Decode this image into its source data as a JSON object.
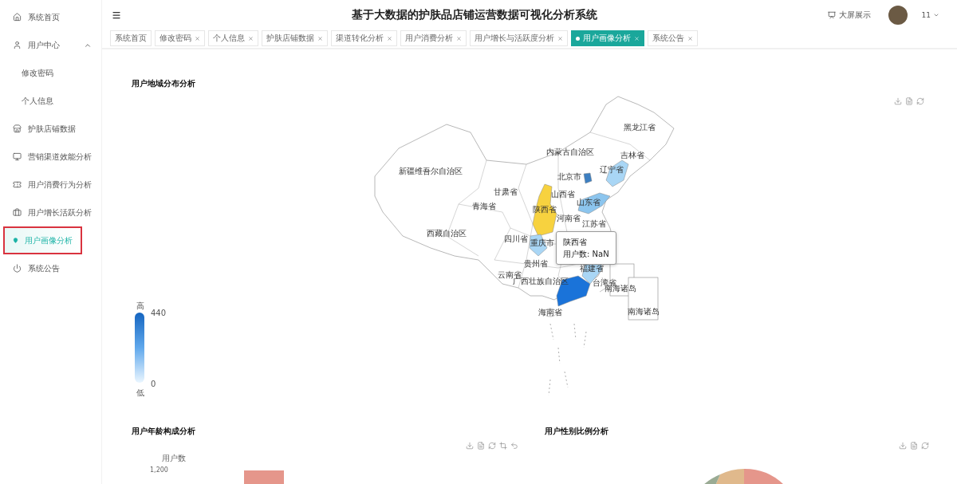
{
  "header": {
    "title": "基于大数据的护肤品店铺运营数据可视化分析系统",
    "screen_button": "大屏展示",
    "user": "11"
  },
  "sidebar": {
    "items": [
      {
        "label": "系统首页",
        "selected": false
      },
      {
        "label": "用户中心",
        "selected": false,
        "expanded": true,
        "children": [
          {
            "label": "修改密码",
            "selected": false
          },
          {
            "label": "个人信息",
            "selected": false
          }
        ]
      },
      {
        "label": "护肤店铺数据",
        "selected": false
      },
      {
        "label": "营销渠道效能分析",
        "selected": false
      },
      {
        "label": "用户消费行为分析",
        "selected": false
      },
      {
        "label": "用户增长活跃分析",
        "selected": false
      },
      {
        "label": "用户画像分析",
        "selected": true
      },
      {
        "label": "系统公告",
        "selected": false
      }
    ]
  },
  "tabs": [
    {
      "label": "系统首页",
      "selected": false,
      "closable": false
    },
    {
      "label": "修改密码",
      "selected": false,
      "closable": true
    },
    {
      "label": "个人信息",
      "selected": false,
      "closable": true
    },
    {
      "label": "护肤店铺数据",
      "selected": false,
      "closable": true
    },
    {
      "label": "渠道转化分析",
      "selected": false,
      "closable": true
    },
    {
      "label": "用户消费分析",
      "selected": false,
      "closable": true
    },
    {
      "label": "用户增长与活跃度分析",
      "selected": false,
      "closable": true
    },
    {
      "label": "用户画像分析",
      "selected": true,
      "closable": true
    },
    {
      "label": "系统公告",
      "selected": false,
      "closable": true
    }
  ],
  "region_map": {
    "title": "用户地域分布分析",
    "legend": {
      "high": "高",
      "max": "440",
      "min": "0",
      "low": "低"
    },
    "provinces": [
      {
        "label": "黑龙江省"
      },
      {
        "label": "吉林省"
      },
      {
        "label": "辽宁省",
        "color": "#a9d6f5"
      },
      {
        "label": "内蒙古自治区"
      },
      {
        "label": "新疆维吾尔自治区"
      },
      {
        "label": "北京市",
        "color": "#3d7fc1"
      },
      {
        "label": "甘肃省"
      },
      {
        "label": "山西省"
      },
      {
        "label": "陕西省",
        "color": "#f7d23f"
      },
      {
        "label": "山东省",
        "color": "#8cc5ee"
      },
      {
        "label": "青海省"
      },
      {
        "label": "河南省"
      },
      {
        "label": "江苏省"
      },
      {
        "label": "西藏自治区"
      },
      {
        "label": "四川省"
      },
      {
        "label": "重庆市",
        "color": "#a9d6f5"
      },
      {
        "label": "贵州省"
      },
      {
        "label": "云南省"
      },
      {
        "label": "广西壮族自治区"
      },
      {
        "label": "福建省",
        "color": "#a9d6f5"
      },
      {
        "label": "台湾省"
      },
      {
        "label": "海南省"
      },
      {
        "label": "南海诸岛"
      },
      {
        "label": "南海诸岛"
      }
    ],
    "tooltip": {
      "name": "陕西省",
      "value": "用户数: NaN"
    }
  },
  "age_chart": {
    "title": "用户年龄构成分析",
    "y_axis_name": "用户数",
    "y_tick": "1,200"
  },
  "gender_chart": {
    "title": "用户性别比例分析"
  }
}
